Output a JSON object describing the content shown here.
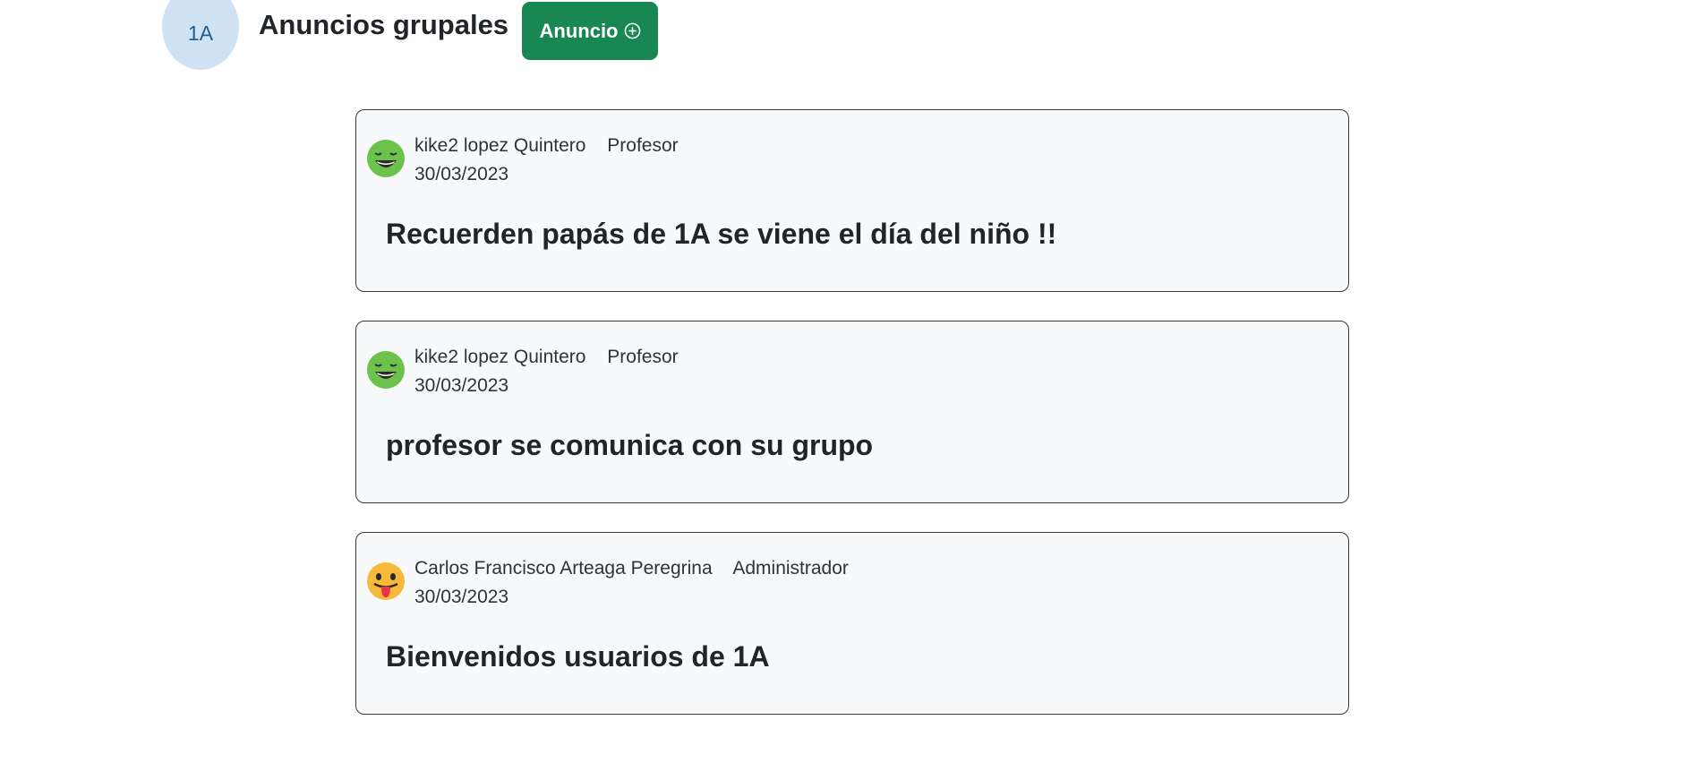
{
  "header": {
    "group_code": "1A",
    "title": "Anuncios grupales",
    "new_button_label": "Anuncio",
    "new_button_icon": "plus-circle-icon",
    "button_color": "#198754",
    "avatar_color": "#cfe2f3"
  },
  "announcements": [
    {
      "author": "kike2 lopez Quintero",
      "role": "Profesor",
      "date": "30/03/2023",
      "message": "Recuerden papás de 1A se viene el día del niño !!",
      "avatar_icon": "smiling-face-icon",
      "avatar_color": "#6cc24a"
    },
    {
      "author": "kike2 lopez Quintero",
      "role": "Profesor",
      "date": "30/03/2023",
      "message": "profesor se comunica con su grupo",
      "avatar_icon": "smiling-face-icon",
      "avatar_color": "#6cc24a"
    },
    {
      "author": "Carlos Francisco Arteaga Peregrina",
      "role": "Administrador",
      "date": "30/03/2023",
      "message": "Bienvenidos usuarios de 1A",
      "avatar_icon": "tongue-out-face-icon",
      "avatar_color": "#f6b93b"
    }
  ]
}
